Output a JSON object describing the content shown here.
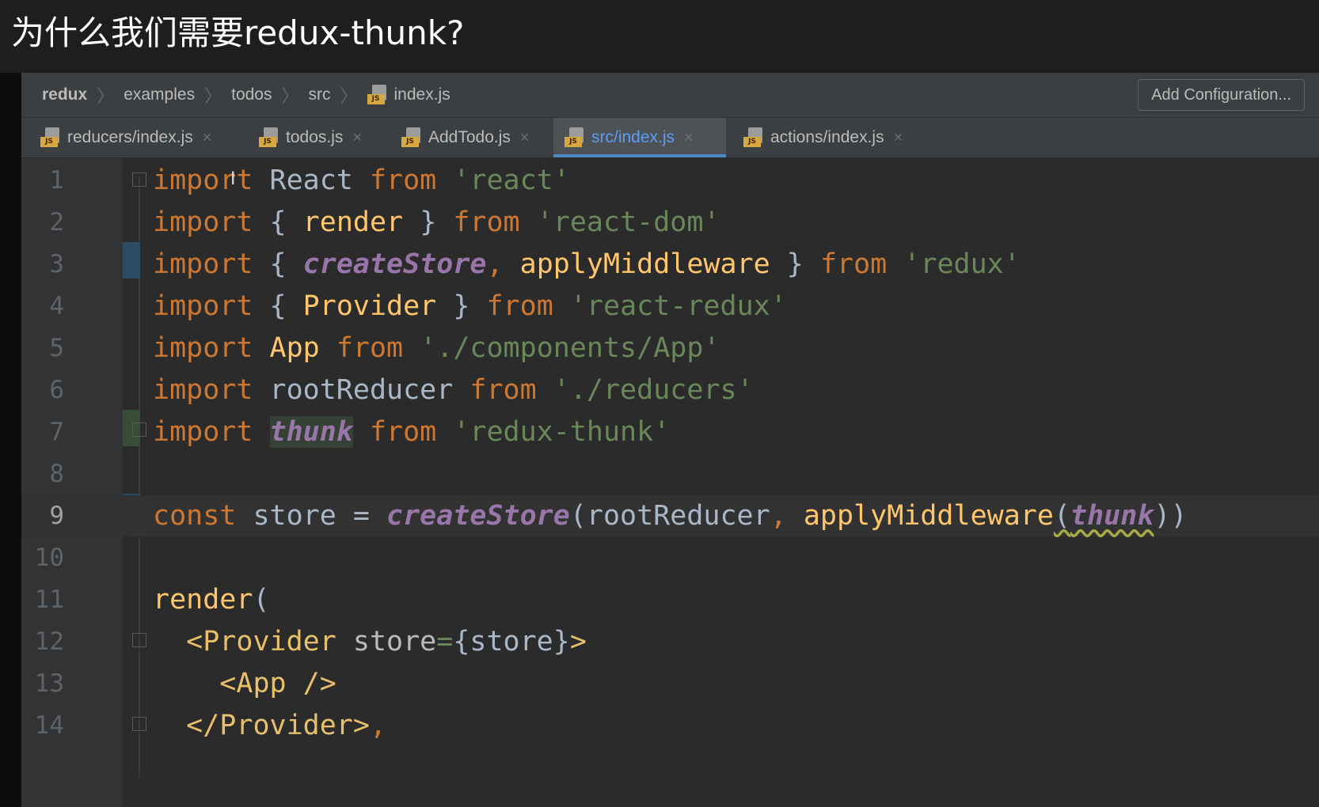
{
  "page_title": "为什么我们需要redux-thunk?",
  "breadcrumb": [
    "redux",
    "examples",
    "todos",
    "src",
    "index.js"
  ],
  "breadcrumb_file_icon": "js-file-icon",
  "add_configuration_label": "Add Configuration...",
  "tabs": [
    {
      "label": "reducers/index.js",
      "active": false
    },
    {
      "label": "todos.js",
      "active": false
    },
    {
      "label": "AddTodo.js",
      "active": false
    },
    {
      "label": "src/index.js",
      "active": true
    },
    {
      "label": "actions/index.js",
      "active": false
    }
  ],
  "tab_close_glyph": "×",
  "colors": {
    "keyword": "#cc7832",
    "string": "#6a8759",
    "function": "#ffc66d",
    "imported_identifier": "#9876aa",
    "active_tab": "#589df6",
    "editor_bg": "#2b2b2b"
  },
  "line_numbers": [
    "1",
    "2",
    "3",
    "4",
    "5",
    "6",
    "7",
    "8",
    "9",
    "10",
    "11",
    "12",
    "13",
    "14"
  ],
  "current_line": "9",
  "code": {
    "l1": {
      "kw": "import",
      "id": "React",
      "from": "from",
      "str": "'react'"
    },
    "l2": {
      "kw": "import",
      "open": "{",
      "id": "render",
      "close": "}",
      "from": "from",
      "str": "'react-dom'"
    },
    "l3": {
      "kw": "import",
      "open": "{",
      "id1": "createStore",
      "comma": ",",
      "id2": "applyMiddleware",
      "close": "}",
      "from": "from",
      "str": "'redux'"
    },
    "l4": {
      "kw": "import",
      "open": "{",
      "id": "Provider",
      "close": "}",
      "from": "from",
      "str": "'react-redux'"
    },
    "l5": {
      "kw": "import",
      "id": "App",
      "from": "from",
      "str": "'./components/App'"
    },
    "l6": {
      "kw": "import",
      "id": "rootReducer",
      "from": "from",
      "str": "'./reducers'"
    },
    "l7": {
      "kw": "import",
      "id": "thunk",
      "from": "from",
      "str": "'redux-thunk'"
    },
    "l9": {
      "kw": "const",
      "id": "store",
      "eq": "=",
      "fn1": "createStore",
      "p1": "(",
      "arg1": "rootReducer",
      "comma": ",",
      "fn2": "applyMiddleware",
      "p2": "(",
      "arg2": "thunk",
      "p3": "))"
    },
    "l11": {
      "fn": "render",
      "p": "("
    },
    "l12": {
      "open": "<Provider",
      "attr": "store",
      "eq": "=",
      "val": "{store}",
      "close": ">"
    },
    "l13": {
      "tag": "<App />"
    },
    "l14": {
      "tag": "</Provider>",
      "comma": ","
    }
  }
}
